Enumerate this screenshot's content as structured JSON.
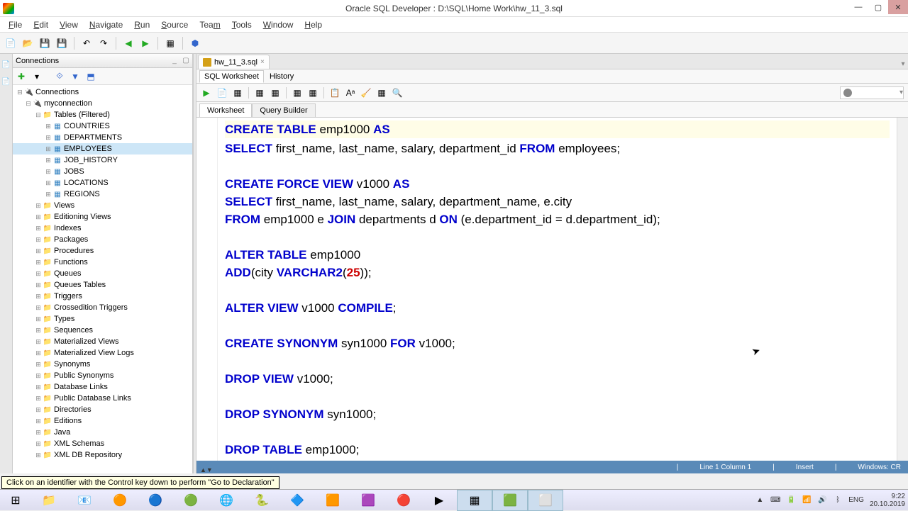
{
  "title": "Oracle SQL Developer : D:\\SQL\\Home Work\\hw_11_3.sql",
  "menu": [
    "File",
    "Edit",
    "View",
    "Navigate",
    "Run",
    "Source",
    "Team",
    "Tools",
    "Window",
    "Help"
  ],
  "conn_panel_title": "Connections",
  "editor_tab": "hw_11_3.sql",
  "subtabs1": {
    "sql": "SQL Worksheet",
    "history": "History"
  },
  "subtabs2": {
    "worksheet": "Worksheet",
    "qb": "Query Builder"
  },
  "tree": {
    "root": "Connections",
    "conn": "myconnection",
    "tables_filtered": "Tables (Filtered)",
    "tables": [
      "COUNTRIES",
      "DEPARTMENTS",
      "EMPLOYEES",
      "JOB_HISTORY",
      "JOBS",
      "LOCATIONS",
      "REGIONS"
    ],
    "selected_table": "EMPLOYEES",
    "folders": [
      "Views",
      "Editioning Views",
      "Indexes",
      "Packages",
      "Procedures",
      "Functions",
      "Queues",
      "Queues Tables",
      "Triggers",
      "Crossedition Triggers",
      "Types",
      "Sequences",
      "Materialized Views",
      "Materialized View Logs",
      "Synonyms",
      "Public Synonyms",
      "Database Links",
      "Public Database Links",
      "Directories",
      "Editions",
      "Java",
      "XML Schemas",
      "XML DB Repository"
    ]
  },
  "hint": "Click on an identifier with the Control key down to perform \"Go to Declaration\"",
  "status": {
    "pos": "Line 1 Column 1",
    "mode": "Insert",
    "os": "Windows: CR"
  },
  "tray": {
    "lang": "ENG",
    "time": "9:22",
    "date": "20.10.2019"
  },
  "code_tokens": [
    [
      {
        "t": "CREATE TABLE",
        "c": "kw"
      },
      {
        "t": " emp1000 "
      },
      {
        "t": "AS",
        "c": "kw"
      }
    ],
    [
      {
        "t": "SELECT",
        "c": "kw"
      },
      {
        "t": " first_name, last_name, salary, department_id "
      },
      {
        "t": "FROM",
        "c": "kw"
      },
      {
        "t": " employees;"
      }
    ],
    [],
    [
      {
        "t": "CREATE FORCE VIEW",
        "c": "kw"
      },
      {
        "t": " v1000 "
      },
      {
        "t": "AS",
        "c": "kw"
      }
    ],
    [
      {
        "t": "SELECT",
        "c": "kw"
      },
      {
        "t": " first_name, last_name, salary, department_name, e.city"
      }
    ],
    [
      {
        "t": "FROM",
        "c": "kw"
      },
      {
        "t": " emp1000 e "
      },
      {
        "t": "JOIN",
        "c": "kw"
      },
      {
        "t": " departments d "
      },
      {
        "t": "ON",
        "c": "kw"
      },
      {
        "t": " (e.department_id = d.department_id);"
      }
    ],
    [],
    [
      {
        "t": "ALTER TABLE",
        "c": "kw"
      },
      {
        "t": " emp1000"
      }
    ],
    [
      {
        "t": "ADD",
        "c": "kw"
      },
      {
        "t": "(city "
      },
      {
        "t": "VARCHAR2",
        "c": "kw"
      },
      {
        "t": "("
      },
      {
        "t": "25",
        "c": "num"
      },
      {
        "t": "));"
      }
    ],
    [],
    [
      {
        "t": "ALTER VIEW",
        "c": "kw"
      },
      {
        "t": " v1000 "
      },
      {
        "t": "COMPILE",
        "c": "kw"
      },
      {
        "t": ";"
      }
    ],
    [],
    [
      {
        "t": "CREATE SYNONYM",
        "c": "kw"
      },
      {
        "t": " syn1000 "
      },
      {
        "t": "FOR",
        "c": "kw"
      },
      {
        "t": " v1000;"
      }
    ],
    [],
    [
      {
        "t": "DROP VIEW",
        "c": "kw"
      },
      {
        "t": " v1000;"
      }
    ],
    [],
    [
      {
        "t": "DROP SYNONYM",
        "c": "kw"
      },
      {
        "t": " syn1000;"
      }
    ],
    [],
    [
      {
        "t": "DROP TABLE",
        "c": "kw"
      },
      {
        "t": " emp1000;"
      }
    ]
  ]
}
